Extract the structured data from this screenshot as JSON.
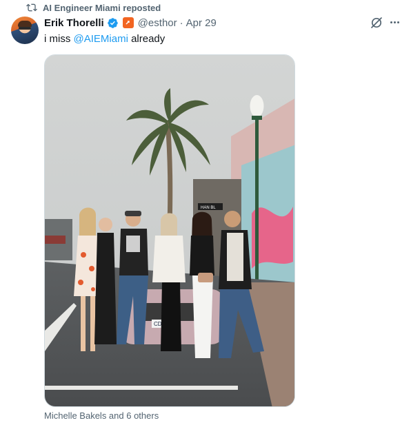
{
  "repost": {
    "text": "AI Engineer Miami reposted",
    "icon": "repost-icon"
  },
  "author": {
    "name": "Erik Thorelli",
    "verified": true,
    "verified_color": "#1d9bf0",
    "affiliate_badge_color": "#f26522",
    "handle": "@esthor",
    "separator": "·",
    "time": "Apr 29"
  },
  "tweet": {
    "text_before": "i miss ",
    "mention": "@AIEMiami",
    "text_after": " already",
    "mention_color": "#1d9bf0"
  },
  "media": {
    "plate_text": "CDE RBT",
    "sign_text": "HAN BL"
  },
  "tagged_users": "Michelle Bakels and 6 others",
  "actions": {
    "grok_icon": "grok-icon",
    "more_icon": "more-icon"
  }
}
